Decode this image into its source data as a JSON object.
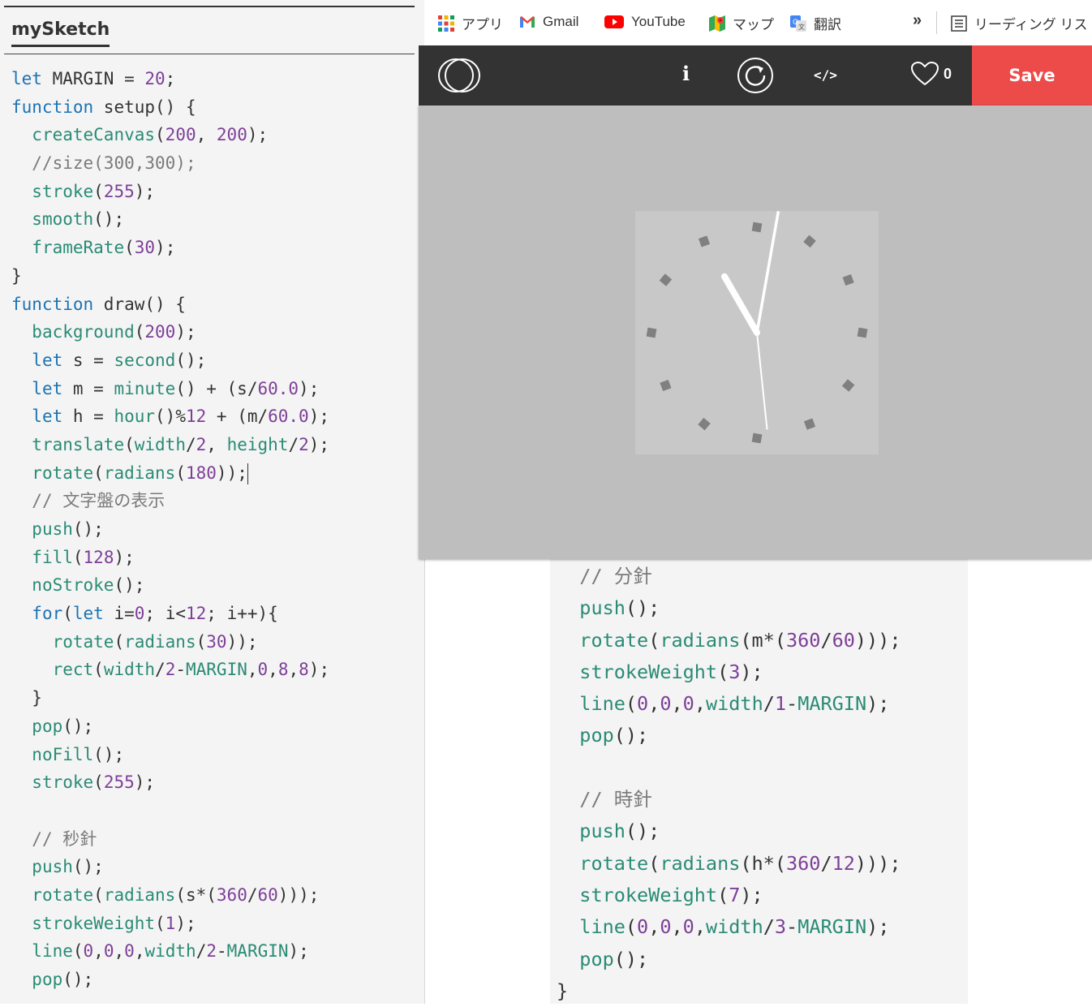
{
  "editor": {
    "tab_title": "mySketch",
    "left_code": [
      [
        [
          "kw",
          "let"
        ],
        [
          "pl",
          " MARGIN = "
        ],
        [
          "num",
          "20"
        ],
        [
          "pl",
          ";"
        ]
      ],
      [
        [
          "kw",
          "function"
        ],
        [
          "pl",
          " setup() {"
        ]
      ],
      [
        [
          "pl",
          "  "
        ],
        [
          "fn",
          "createCanvas"
        ],
        [
          "pl",
          "("
        ],
        [
          "num",
          "200"
        ],
        [
          "pl",
          ", "
        ],
        [
          "num",
          "200"
        ],
        [
          "pl",
          ");"
        ]
      ],
      [
        [
          "pl",
          "  "
        ],
        [
          "cm",
          "//size(300,300);"
        ]
      ],
      [
        [
          "pl",
          "  "
        ],
        [
          "fn",
          "stroke"
        ],
        [
          "pl",
          "("
        ],
        [
          "num",
          "255"
        ],
        [
          "pl",
          ");"
        ]
      ],
      [
        [
          "pl",
          "  "
        ],
        [
          "fn",
          "smooth"
        ],
        [
          "pl",
          "();"
        ]
      ],
      [
        [
          "pl",
          "  "
        ],
        [
          "fn",
          "frameRate"
        ],
        [
          "pl",
          "("
        ],
        [
          "num",
          "30"
        ],
        [
          "pl",
          ");"
        ]
      ],
      [
        [
          "pl",
          "}"
        ]
      ],
      [
        [
          "kw",
          "function"
        ],
        [
          "pl",
          " draw() {"
        ]
      ],
      [
        [
          "pl",
          "  "
        ],
        [
          "fn",
          "background"
        ],
        [
          "pl",
          "("
        ],
        [
          "num",
          "200"
        ],
        [
          "pl",
          ");"
        ]
      ],
      [
        [
          "pl",
          "  "
        ],
        [
          "kw",
          "let"
        ],
        [
          "pl",
          " s = "
        ],
        [
          "fn",
          "second"
        ],
        [
          "pl",
          "();"
        ]
      ],
      [
        [
          "pl",
          "  "
        ],
        [
          "kw",
          "let"
        ],
        [
          "pl",
          " m = "
        ],
        [
          "fn",
          "minute"
        ],
        [
          "pl",
          "() + (s/"
        ],
        [
          "num",
          "60.0"
        ],
        [
          "pl",
          ");"
        ]
      ],
      [
        [
          "pl",
          "  "
        ],
        [
          "kw",
          "let"
        ],
        [
          "pl",
          " h = "
        ],
        [
          "fn",
          "hour"
        ],
        [
          "pl",
          "()%"
        ],
        [
          "num",
          "12"
        ],
        [
          "pl",
          " + (m/"
        ],
        [
          "num",
          "60.0"
        ],
        [
          "pl",
          ");"
        ]
      ],
      [
        [
          "pl",
          "  "
        ],
        [
          "fn",
          "translate"
        ],
        [
          "pl",
          "("
        ],
        [
          "fn",
          "width"
        ],
        [
          "pl",
          "/"
        ],
        [
          "num",
          "2"
        ],
        [
          "pl",
          ", "
        ],
        [
          "fn",
          "height"
        ],
        [
          "pl",
          "/"
        ],
        [
          "num",
          "2"
        ],
        [
          "pl",
          ");"
        ]
      ],
      [
        [
          "pl",
          "  "
        ],
        [
          "fn",
          "rotate"
        ],
        [
          "pl",
          "("
        ],
        [
          "fn",
          "radians"
        ],
        [
          "pl",
          "("
        ],
        [
          "num",
          "180"
        ],
        [
          "pl",
          "));"
        ],
        [
          "caret",
          ""
        ]
      ],
      [
        [
          "pl",
          "  "
        ],
        [
          "cm",
          "// 文字盤の表示"
        ]
      ],
      [
        [
          "pl",
          "  "
        ],
        [
          "fn",
          "push"
        ],
        [
          "pl",
          "();"
        ]
      ],
      [
        [
          "pl",
          "  "
        ],
        [
          "fn",
          "fill"
        ],
        [
          "pl",
          "("
        ],
        [
          "num",
          "128"
        ],
        [
          "pl",
          ");"
        ]
      ],
      [
        [
          "pl",
          "  "
        ],
        [
          "fn",
          "noStroke"
        ],
        [
          "pl",
          "();"
        ]
      ],
      [
        [
          "pl",
          "  "
        ],
        [
          "kw",
          "for"
        ],
        [
          "pl",
          "("
        ],
        [
          "kw",
          "let"
        ],
        [
          "pl",
          " i="
        ],
        [
          "num",
          "0"
        ],
        [
          "pl",
          "; i<"
        ],
        [
          "num",
          "12"
        ],
        [
          "pl",
          "; i++){"
        ]
      ],
      [
        [
          "pl",
          "    "
        ],
        [
          "fn",
          "rotate"
        ],
        [
          "pl",
          "("
        ],
        [
          "fn",
          "radians"
        ],
        [
          "pl",
          "("
        ],
        [
          "num",
          "30"
        ],
        [
          "pl",
          "));"
        ]
      ],
      [
        [
          "pl",
          "    "
        ],
        [
          "fn",
          "rect"
        ],
        [
          "pl",
          "("
        ],
        [
          "fn",
          "width"
        ],
        [
          "pl",
          "/"
        ],
        [
          "num",
          "2"
        ],
        [
          "pl",
          "-"
        ],
        [
          "fn",
          "MARGIN"
        ],
        [
          "pl",
          ","
        ],
        [
          "num",
          "0"
        ],
        [
          "pl",
          ","
        ],
        [
          "num",
          "8"
        ],
        [
          "pl",
          ","
        ],
        [
          "num",
          "8"
        ],
        [
          "pl",
          ");"
        ]
      ],
      [
        [
          "pl",
          "  }"
        ]
      ],
      [
        [
          "pl",
          "  "
        ],
        [
          "fn",
          "pop"
        ],
        [
          "pl",
          "();"
        ]
      ],
      [
        [
          "pl",
          "  "
        ],
        [
          "fn",
          "noFill"
        ],
        [
          "pl",
          "();"
        ]
      ],
      [
        [
          "pl",
          "  "
        ],
        [
          "fn",
          "stroke"
        ],
        [
          "pl",
          "("
        ],
        [
          "num",
          "255"
        ],
        [
          "pl",
          ");"
        ]
      ],
      [
        [
          "pl",
          ""
        ]
      ],
      [
        [
          "pl",
          "  "
        ],
        [
          "cm",
          "// 秒針"
        ]
      ],
      [
        [
          "pl",
          "  "
        ],
        [
          "fn",
          "push"
        ],
        [
          "pl",
          "();"
        ]
      ],
      [
        [
          "pl",
          "  "
        ],
        [
          "fn",
          "rotate"
        ],
        [
          "pl",
          "("
        ],
        [
          "fn",
          "radians"
        ],
        [
          "pl",
          "(s*("
        ],
        [
          "num",
          "360"
        ],
        [
          "pl",
          "/"
        ],
        [
          "num",
          "60"
        ],
        [
          "pl",
          ")));"
        ]
      ],
      [
        [
          "pl",
          "  "
        ],
        [
          "fn",
          "strokeWeight"
        ],
        [
          "pl",
          "("
        ],
        [
          "num",
          "1"
        ],
        [
          "pl",
          ");"
        ]
      ],
      [
        [
          "pl",
          "  "
        ],
        [
          "fn",
          "line"
        ],
        [
          "pl",
          "("
        ],
        [
          "num",
          "0"
        ],
        [
          "pl",
          ","
        ],
        [
          "num",
          "0"
        ],
        [
          "pl",
          ","
        ],
        [
          "num",
          "0"
        ],
        [
          "pl",
          ","
        ],
        [
          "fn",
          "width"
        ],
        [
          "pl",
          "/"
        ],
        [
          "num",
          "2"
        ],
        [
          "pl",
          "-"
        ],
        [
          "fn",
          "MARGIN"
        ],
        [
          "pl",
          ");"
        ]
      ],
      [
        [
          "pl",
          "  "
        ],
        [
          "fn",
          "pop"
        ],
        [
          "pl",
          "();"
        ]
      ]
    ],
    "right_code": [
      [
        [
          "pl",
          "  "
        ],
        [
          "cm",
          "// 分針"
        ]
      ],
      [
        [
          "pl",
          "  "
        ],
        [
          "fn",
          "push"
        ],
        [
          "pl",
          "();"
        ]
      ],
      [
        [
          "pl",
          "  "
        ],
        [
          "fn",
          "rotate"
        ],
        [
          "pl",
          "("
        ],
        [
          "fn",
          "radians"
        ],
        [
          "pl",
          "(m*("
        ],
        [
          "num",
          "360"
        ],
        [
          "pl",
          "/"
        ],
        [
          "num",
          "60"
        ],
        [
          "pl",
          ")));"
        ]
      ],
      [
        [
          "pl",
          "  "
        ],
        [
          "fn",
          "strokeWeight"
        ],
        [
          "pl",
          "("
        ],
        [
          "num",
          "3"
        ],
        [
          "pl",
          ");"
        ]
      ],
      [
        [
          "pl",
          "  "
        ],
        [
          "fn",
          "line"
        ],
        [
          "pl",
          "("
        ],
        [
          "num",
          "0"
        ],
        [
          "pl",
          ","
        ],
        [
          "num",
          "0"
        ],
        [
          "pl",
          ","
        ],
        [
          "num",
          "0"
        ],
        [
          "pl",
          ","
        ],
        [
          "fn",
          "width"
        ],
        [
          "pl",
          "/"
        ],
        [
          "num",
          "1"
        ],
        [
          "pl",
          "-"
        ],
        [
          "fn",
          "MARGIN"
        ],
        [
          "pl",
          ");"
        ]
      ],
      [
        [
          "pl",
          "  "
        ],
        [
          "fn",
          "pop"
        ],
        [
          "pl",
          "();"
        ]
      ],
      [
        [
          "pl",
          ""
        ]
      ],
      [
        [
          "pl",
          "  "
        ],
        [
          "cm",
          "// 時針"
        ]
      ],
      [
        [
          "pl",
          "  "
        ],
        [
          "fn",
          "push"
        ],
        [
          "pl",
          "();"
        ]
      ],
      [
        [
          "pl",
          "  "
        ],
        [
          "fn",
          "rotate"
        ],
        [
          "pl",
          "("
        ],
        [
          "fn",
          "radians"
        ],
        [
          "pl",
          "(h*("
        ],
        [
          "num",
          "360"
        ],
        [
          "pl",
          "/"
        ],
        [
          "num",
          "12"
        ],
        [
          "pl",
          ")));"
        ]
      ],
      [
        [
          "pl",
          "  "
        ],
        [
          "fn",
          "strokeWeight"
        ],
        [
          "pl",
          "("
        ],
        [
          "num",
          "7"
        ],
        [
          "pl",
          ");"
        ]
      ],
      [
        [
          "pl",
          "  "
        ],
        [
          "fn",
          "line"
        ],
        [
          "pl",
          "("
        ],
        [
          "num",
          "0"
        ],
        [
          "pl",
          ","
        ],
        [
          "num",
          "0"
        ],
        [
          "pl",
          ","
        ],
        [
          "num",
          "0"
        ],
        [
          "pl",
          ","
        ],
        [
          "fn",
          "width"
        ],
        [
          "pl",
          "/"
        ],
        [
          "num",
          "3"
        ],
        [
          "pl",
          "-"
        ],
        [
          "fn",
          "MARGIN"
        ],
        [
          "pl",
          ");"
        ]
      ],
      [
        [
          "pl",
          "  "
        ],
        [
          "fn",
          "pop"
        ],
        [
          "pl",
          "();"
        ]
      ],
      [
        [
          "pl",
          "}"
        ]
      ]
    ]
  },
  "bookmarks": {
    "apps": "アプリ",
    "gmail": "Gmail",
    "youtube": "YouTube",
    "maps": "マップ",
    "translate": "翻訳",
    "more": "»",
    "reading_list": "リーディング リスト"
  },
  "toolbar": {
    "info": "i",
    "code": "</>",
    "like_count": "0",
    "save": "Save"
  },
  "colors": {
    "keyword": "#1c73b3",
    "function": "#2a8b75",
    "number": "#7d3f98",
    "comment": "#7a7a7a",
    "header_bg": "#333333",
    "save_bg": "#ed4a4a",
    "preview_bg": "#bebebe",
    "canvas_bg": "#c8c8c8"
  },
  "clock": {
    "tick_count": 12,
    "tick_color": "#808080",
    "hand_color": "#ffffff",
    "hour_deg": 330,
    "minute_deg": 10,
    "second_deg": 174
  }
}
